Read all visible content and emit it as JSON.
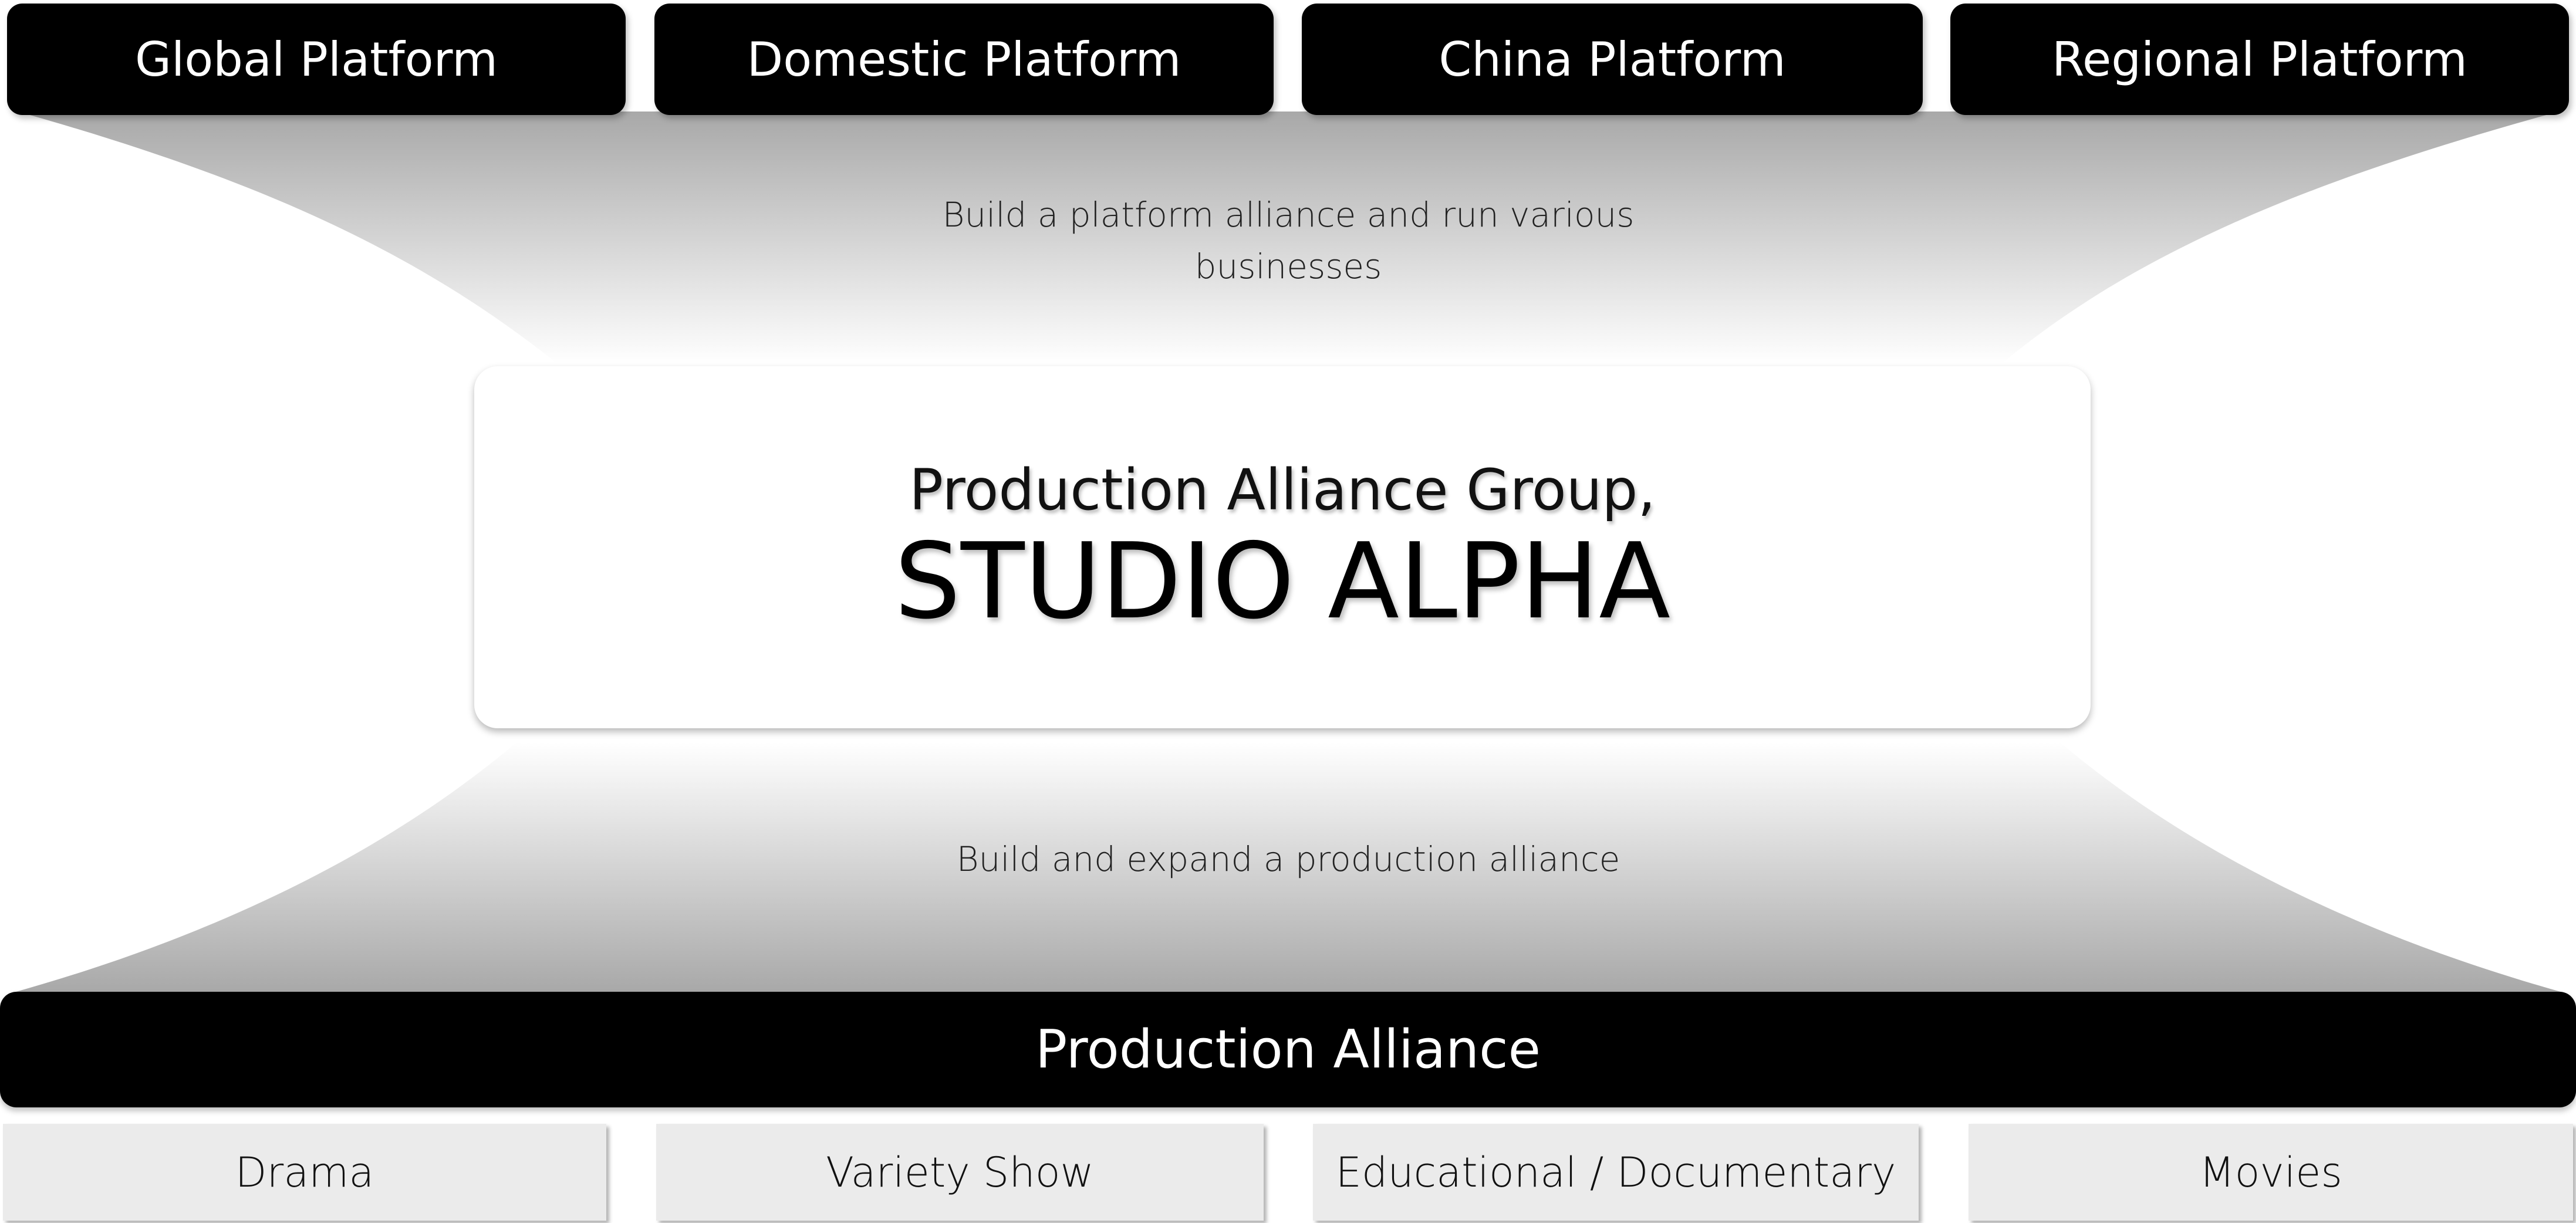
{
  "platforms": [
    {
      "label": "Global Platform"
    },
    {
      "label": "Domestic Platform"
    },
    {
      "label": "China Platform"
    },
    {
      "label": "Regional Platform"
    }
  ],
  "top_caption": {
    "line1": "Build a platform alliance and run various",
    "line2": "businesses"
  },
  "center": {
    "subtitle": "Production Alliance Group,",
    "title": "STUDIO ALPHA"
  },
  "bottom_caption": "Build and expand a production alliance",
  "alliance_bar": {
    "label": "Production Alliance"
  },
  "categories": [
    {
      "label": "Drama"
    },
    {
      "label": "Variety Show"
    },
    {
      "label": "Educational / Documentary"
    },
    {
      "label": "Movies"
    }
  ],
  "colors": {
    "bar_fill": "#000000",
    "category_fill": "#ebebeb",
    "funnel_dark": "#a8a8a8",
    "funnel_light": "#ffffff"
  }
}
